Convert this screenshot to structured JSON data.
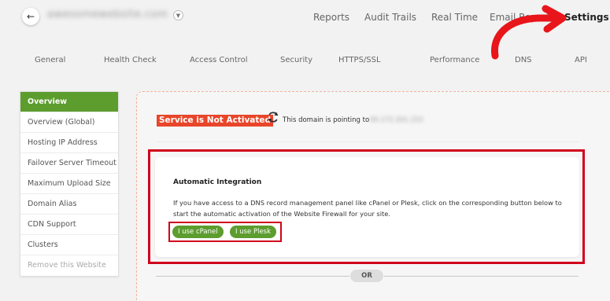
{
  "header": {
    "domain": "awesomewebsite.com",
    "nav": [
      "Reports",
      "Audit Trails",
      "Real Time",
      "Email Reports",
      "Settings"
    ]
  },
  "subnav": [
    "General",
    "Health Check",
    "Access Control",
    "Security",
    "HTTPS/SSL",
    "Performance",
    "DNS",
    "API"
  ],
  "sidebar": {
    "items": [
      "Overview",
      "Overview (Global)",
      "Hosting IP Address",
      "Failover Server Timeout",
      "Maximum Upload Size",
      "Domain Alias",
      "CDN Support",
      "Clusters",
      "Remove this Website"
    ]
  },
  "main": {
    "status_badge": "Service is Not Activated",
    "pointing_text": "This domain is pointing to",
    "ip": "00.172.201.153",
    "integration": {
      "title": "Automatic Integration",
      "text": "If you have access to a DNS record management panel like cPanel or Plesk, click on the corresponding button below to start the automatic activation of the Website Firewall for your site.",
      "cpanel_btn": "I use cPanel",
      "plesk_btn": "I use Plesk"
    },
    "or_label": "OR"
  },
  "colors": {
    "accent_green": "#5c9d2e",
    "badge_red": "#e8462a",
    "highlight_red": "#d0021b"
  }
}
